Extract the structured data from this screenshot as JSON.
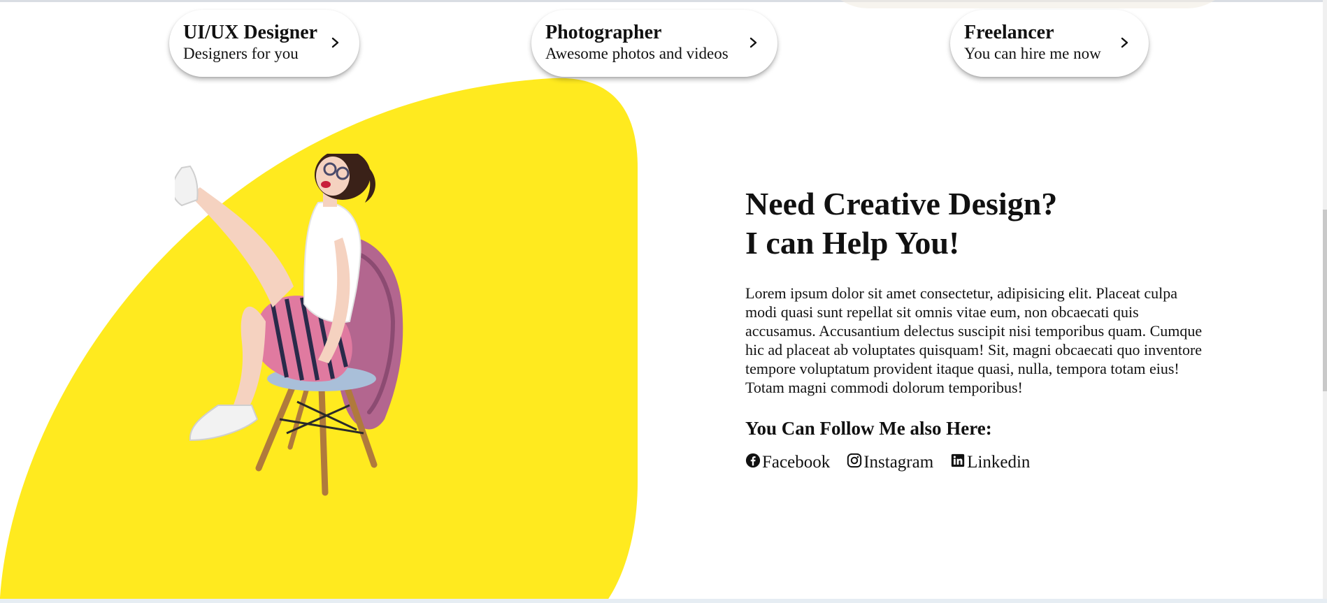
{
  "services": [
    {
      "title": "UI/UX Designer",
      "subtitle": "Designers for you",
      "icon": "chevron-right-icon"
    },
    {
      "title": "Photographer",
      "subtitle": "Awesome photos and videos",
      "icon": "chevron-right-icon"
    },
    {
      "title": "Freelancer",
      "subtitle": "You can hire me now",
      "icon": "chevron-right-icon"
    }
  ],
  "about": {
    "headline_line1": "Need Creative Design?",
    "headline_line2": "I can Help You!",
    "body": "Lorem ipsum dolor sit amet consectetur, adipisicing elit. Placeat culpa modi quasi sunt repellat sit omnis vitae eum, non obcaecati quis accusamus. Accusantium delectus suscipit nisi temporibus quam. Cumque hic ad placeat ab voluptates quisquam! Sit, magni obcaecati quo inventore tempore voluptatum provident itaque quasi, nulla, tempora totam eius! Totam magni commodi dolorum temporibus!",
    "follow_title": "You Can Follow Me also Here:"
  },
  "social": [
    {
      "label": "Facebook",
      "icon": "facebook-icon"
    },
    {
      "label": "Instagram",
      "icon": "instagram-icon"
    },
    {
      "label": "Linkedin",
      "icon": "linkedin-icon"
    }
  ],
  "colors": {
    "accent_yellow": "#ffea1f",
    "text": "#111111",
    "pill_bg": "#ffffff"
  }
}
